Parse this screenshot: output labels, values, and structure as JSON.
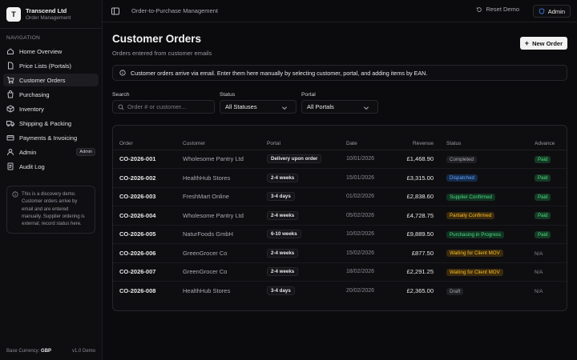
{
  "brand": {
    "logo_letter": "T",
    "name": "Transcend Ltd",
    "subtitle": "Order Management"
  },
  "nav": {
    "heading": "NAVIGATION",
    "items": [
      {
        "label": "Home Overview",
        "icon": "home-icon"
      },
      {
        "label": "Price Lists (Portals)",
        "icon": "file-icon"
      },
      {
        "label": "Customer Orders",
        "icon": "cart-icon",
        "active": true
      },
      {
        "label": "Purchasing",
        "icon": "bag-icon"
      },
      {
        "label": "Inventory",
        "icon": "box-icon"
      },
      {
        "label": "Shipping & Packing",
        "icon": "truck-icon"
      },
      {
        "label": "Payments & Invoicing",
        "icon": "card-icon"
      },
      {
        "label": "Admin",
        "icon": "person-icon",
        "badge": "Admin"
      },
      {
        "label": "Audit Log",
        "icon": "log-icon"
      }
    ]
  },
  "demo_note": "This is a discovery demo. Customer orders arrive by email and are entered manually. Supplier ordering is external; record status here.",
  "footer": {
    "currency_label": "Base Currency:",
    "currency": "GBP",
    "version": "v1.0 Demo"
  },
  "topbar": {
    "title": "Order-to-Purchase Management",
    "reset_label": "Reset Demo",
    "user_label": "Admin"
  },
  "page": {
    "title": "Customer Orders",
    "subtitle": "Orders entered from customer emails",
    "new_order_label": "New Order",
    "banner": "Customer orders arrive via email. Enter them here manually by selecting customer, portal, and adding items by EAN."
  },
  "filters": {
    "search_label": "Search",
    "search_placeholder": "Order # or customer...",
    "status_label": "Status",
    "status_value": "All Statuses",
    "portal_label": "Portal",
    "portal_value": "All Portals"
  },
  "colors": {
    "completed": "#9aa0a6",
    "dispatched": "#3b82f6",
    "supplier_confirmed": "#22c55e",
    "partially_confirmed": "#f59e0b",
    "purchasing": "#22c55e",
    "waiting": "#f59e0b",
    "draft": "#9aa0a6"
  },
  "table": {
    "headers": [
      "Order",
      "Customer",
      "Portal",
      "Date",
      "Revenue",
      "Status",
      "Advance"
    ],
    "rows": [
      {
        "order": "CO-2026-001",
        "customer": "Wholesome Pantry Ltd",
        "portal": "Delivery upon order",
        "date": "10/01/2026",
        "revenue": "£1,468.90",
        "status": "Completed",
        "status_kind": "completed",
        "advance": "Paid"
      },
      {
        "order": "CO-2026-002",
        "customer": "HealthHub Stores",
        "portal": "2-4 weeks",
        "date": "15/01/2026",
        "revenue": "£3,315.00",
        "status": "Dispatched",
        "status_kind": "dispatched",
        "advance": "Paid"
      },
      {
        "order": "CO-2026-003",
        "customer": "FreshMart Online",
        "portal": "3-4 days",
        "date": "01/02/2026",
        "revenue": "£2,838.60",
        "status": "Supplier Confirmed",
        "status_kind": "supplier_confirmed",
        "advance": "Paid"
      },
      {
        "order": "CO-2026-004",
        "customer": "Wholesome Pantry Ltd",
        "portal": "2-4 weeks",
        "date": "05/02/2026",
        "revenue": "£4,728.75",
        "status": "Partially Confirmed",
        "status_kind": "partially_confirmed",
        "advance": "Paid"
      },
      {
        "order": "CO-2026-005",
        "customer": "NaturFoods GmbH",
        "portal": "6-10 weeks",
        "date": "10/02/2026",
        "revenue": "£9,889.50",
        "status": "Purchasing in Progress",
        "status_kind": "purchasing",
        "advance": "Paid"
      },
      {
        "order": "CO-2026-006",
        "customer": "GreenGrocer Co",
        "portal": "2-4 weeks",
        "date": "15/02/2026",
        "revenue": "£877.50",
        "status": "Waiting for Client MOV",
        "status_kind": "waiting",
        "advance": "N/A"
      },
      {
        "order": "CO-2026-007",
        "customer": "GreenGrocer Co",
        "portal": "2-4 weeks",
        "date": "18/02/2026",
        "revenue": "£2,291.25",
        "status": "Waiting for Client MOV",
        "status_kind": "waiting",
        "advance": "N/A"
      },
      {
        "order": "CO-2026-008",
        "customer": "HealthHub Stores",
        "portal": "3-4 days",
        "date": "20/02/2026",
        "revenue": "£2,365.00",
        "status": "Draft",
        "status_kind": "draft",
        "advance": "N/A"
      }
    ]
  }
}
